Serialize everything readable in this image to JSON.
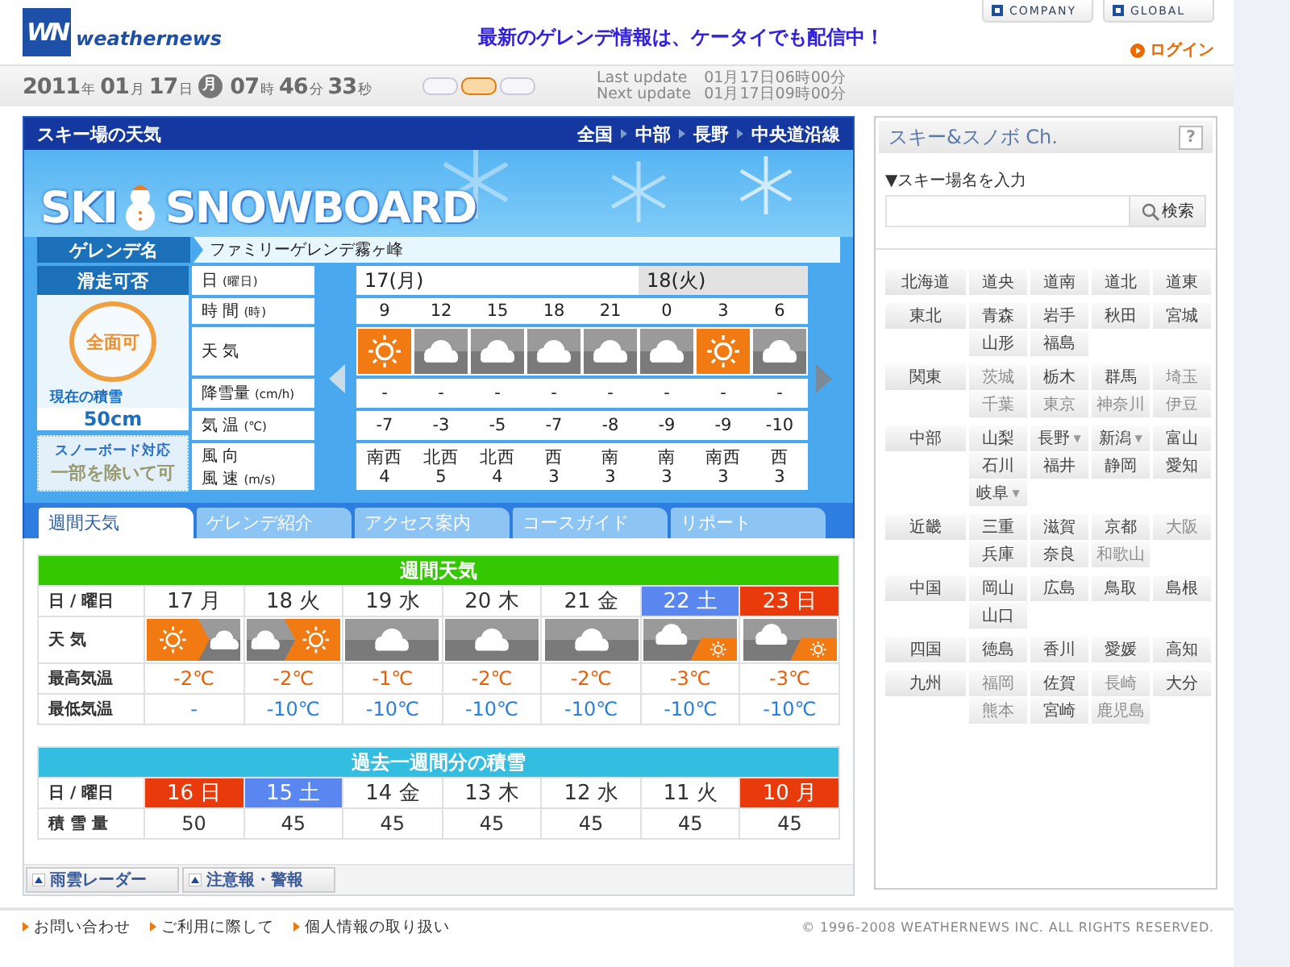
{
  "header": {
    "logo_mark": "WN",
    "logo_name": "weathernews",
    "banner": "最新のゲレンデ情報は、ケータイでも配信中！",
    "links": [
      "COMPANY",
      "GLOBAL"
    ],
    "login": "ログイン"
  },
  "datebar": {
    "clock": [
      {
        "value": "2011",
        "unit": "年"
      },
      {
        "value": "01",
        "unit": "月"
      },
      {
        "value": "17",
        "unit": "日"
      },
      {
        "kind": "weekday",
        "value": "月"
      },
      {
        "value": "07",
        "unit": "時"
      },
      {
        "value": "46",
        "unit": "分"
      },
      {
        "value": "33",
        "unit": "秒"
      }
    ],
    "modes": [
      {
        "selected": false
      },
      {
        "selected": true
      },
      {
        "selected": false
      }
    ],
    "updates": [
      {
        "label": "Last update",
        "value": "01月17日06時00分"
      },
      {
        "label": "Next update",
        "value": "01月17日09時00分"
      }
    ]
  },
  "panel": {
    "title": "スキー場の天気",
    "breadcrumb": [
      "全国",
      "中部",
      "長野",
      "中央道沿線"
    ],
    "art_words": [
      "SKI",
      "SNOWBOARD"
    ],
    "resort_label": "ゲレンデ名",
    "resort_name": "ファミリーゲレンデ霧ヶ峰",
    "status": {
      "title": "滑走可否",
      "verdict": "全面可",
      "snow_label": "現在の積雪",
      "snow_depth": "50cm",
      "board_label": "スノーボード対応",
      "board_value": "一部を除いて可"
    },
    "row_labels": [
      {
        "lines": [
          {
            "text": "日",
            "unit": "(曜日)"
          }
        ]
      },
      {
        "lines": [
          {
            "text": "時 間",
            "unit": "(時)"
          }
        ]
      },
      {
        "lines": [
          {
            "text": "天 気"
          }
        ]
      },
      {
        "lines": [
          {
            "text": "降雪量",
            "unit": "(cm/h)"
          }
        ]
      },
      {
        "lines": [
          {
            "text": "気 温",
            "unit": "(℃)"
          }
        ]
      },
      {
        "lines": [
          {
            "text": "風 向"
          },
          {
            "text": "風 速",
            "unit": "(m/s)"
          }
        ]
      }
    ],
    "days": [
      {
        "label": "17(月)",
        "shaded": false,
        "hours": [
          {
            "time": "9",
            "icon": {
              "kind": "sunny"
            },
            "snowfall": "-",
            "temp": "-7",
            "wind_dir": "南西",
            "wind_speed": "4"
          },
          {
            "time": "12",
            "icon": {
              "kind": "cloudy"
            },
            "snowfall": "-",
            "temp": "-3",
            "wind_dir": "北西",
            "wind_speed": "5"
          },
          {
            "time": "15",
            "icon": {
              "kind": "cloudy"
            },
            "snowfall": "-",
            "temp": "-5",
            "wind_dir": "北西",
            "wind_speed": "4"
          },
          {
            "time": "18",
            "icon": {
              "kind": "cloudy"
            },
            "snowfall": "-",
            "temp": "-7",
            "wind_dir": "西",
            "wind_speed": "3"
          },
          {
            "time": "21",
            "icon": {
              "kind": "cloudy"
            },
            "snowfall": "-",
            "temp": "-8",
            "wind_dir": "南",
            "wind_speed": "3"
          }
        ]
      },
      {
        "label": "18(火)",
        "shaded": true,
        "hours": [
          {
            "time": "0",
            "icon": {
              "kind": "cloudy"
            },
            "snowfall": "-",
            "temp": "-9",
            "wind_dir": "南",
            "wind_speed": "3"
          },
          {
            "time": "3",
            "icon": {
              "kind": "sunny"
            },
            "snowfall": "-",
            "temp": "-9",
            "wind_dir": "南西",
            "wind_speed": "3"
          },
          {
            "time": "6",
            "icon": {
              "kind": "cloudy"
            },
            "snowfall": "-",
            "temp": "-10",
            "wind_dir": "西",
            "wind_speed": "3"
          }
        ]
      }
    ]
  },
  "tabs": [
    {
      "label": "週間天気",
      "selected": true
    },
    {
      "label": "ゲレンデ紹介",
      "selected": false
    },
    {
      "label": "アクセス案内",
      "selected": false
    },
    {
      "label": "コースガイド",
      "selected": false
    },
    {
      "label": "リポート",
      "selected": false
    }
  ],
  "weekly": {
    "title": "週間天気",
    "row_labels": [
      "日 / 曜日",
      "天 気",
      "最高気温",
      "最低気温"
    ],
    "days": [
      {
        "label": "17 月",
        "kind": "weekday",
        "icon": {
          "kind": "sun_to_cloud"
        },
        "high": "-2℃",
        "low": "-"
      },
      {
        "label": "18 火",
        "kind": "weekday",
        "icon": {
          "kind": "cloud_to_sun"
        },
        "high": "-2℃",
        "low": "-10℃"
      },
      {
        "label": "19 水",
        "kind": "weekday",
        "icon": {
          "kind": "cloud"
        },
        "high": "-1℃",
        "low": "-10℃"
      },
      {
        "label": "20 木",
        "kind": "weekday",
        "icon": {
          "kind": "cloud"
        },
        "high": "-2℃",
        "low": "-10℃"
      },
      {
        "label": "21 金",
        "kind": "weekday",
        "icon": {
          "kind": "cloud"
        },
        "high": "-2℃",
        "low": "-10℃"
      },
      {
        "label": "22 土",
        "kind": "saturday",
        "icon": {
          "kind": "cloud_sometimes_sun"
        },
        "high": "-3℃",
        "low": "-10℃"
      },
      {
        "label": "23 日",
        "kind": "holiday",
        "icon": {
          "kind": "cloud_sometimes_sun"
        },
        "high": "-3℃",
        "low": "-10℃"
      }
    ]
  },
  "snow_history": {
    "title": "過去一週間分の積雪",
    "row_labels": [
      "日 / 曜日",
      "積 雪 量"
    ],
    "days": [
      {
        "label": "16 日",
        "kind": "holiday",
        "amount": "50"
      },
      {
        "label": "15 土",
        "kind": "saturday",
        "amount": "45"
      },
      {
        "label": "14 金",
        "kind": "weekday",
        "amount": "45"
      },
      {
        "label": "13 木",
        "kind": "weekday",
        "amount": "45"
      },
      {
        "label": "12 水",
        "kind": "weekday",
        "amount": "45"
      },
      {
        "label": "11 火",
        "kind": "weekday",
        "amount": "45"
      },
      {
        "label": "10 月",
        "kind": "holiday",
        "amount": "45"
      }
    ]
  },
  "bottom_links": [
    "雨雲レーダー",
    "注意報・警報"
  ],
  "sidebar": {
    "title": "スキー&スノボ Ch.",
    "help": "?",
    "search_label": "▼スキー場名を入力",
    "search_button": "検索",
    "regions": [
      {
        "name": "北海道",
        "prefectures": [
          {
            "name": "道央",
            "disabled": false
          },
          {
            "name": "道南",
            "disabled": false
          },
          {
            "name": "道北",
            "disabled": false
          },
          {
            "name": "道東",
            "disabled": false
          }
        ]
      },
      {
        "name": "東北",
        "prefectures": [
          {
            "name": "青森",
            "disabled": false
          },
          {
            "name": "岩手",
            "disabled": false
          },
          {
            "name": "秋田",
            "disabled": false
          },
          {
            "name": "宮城",
            "disabled": false
          },
          {
            "name": "山形",
            "disabled": false
          },
          {
            "name": "福島",
            "disabled": false
          }
        ]
      },
      {
        "name": "関東",
        "prefectures": [
          {
            "name": "茨城",
            "disabled": true
          },
          {
            "name": "栃木",
            "disabled": false
          },
          {
            "name": "群馬",
            "disabled": false
          },
          {
            "name": "埼玉",
            "disabled": true
          },
          {
            "name": "千葉",
            "disabled": true
          },
          {
            "name": "東京",
            "disabled": true
          },
          {
            "name": "神奈川",
            "disabled": true
          },
          {
            "name": "伊豆",
            "disabled": true
          }
        ]
      },
      {
        "name": "中部",
        "prefectures": [
          {
            "name": "山梨",
            "disabled": false
          },
          {
            "name": "長野",
            "disabled": false,
            "menu_mark": "▼"
          },
          {
            "name": "新潟",
            "disabled": false,
            "menu_mark": "▼"
          },
          {
            "name": "富山",
            "disabled": false
          },
          {
            "name": "石川",
            "disabled": false
          },
          {
            "name": "福井",
            "disabled": false
          },
          {
            "name": "静岡",
            "disabled": false
          },
          {
            "name": "愛知",
            "disabled": false
          },
          {
            "name": "岐阜",
            "disabled": false,
            "menu_mark": "▼"
          }
        ]
      },
      {
        "name": "近畿",
        "prefectures": [
          {
            "name": "三重",
            "disabled": false
          },
          {
            "name": "滋賀",
            "disabled": false
          },
          {
            "name": "京都",
            "disabled": false
          },
          {
            "name": "大阪",
            "disabled": true
          },
          {
            "name": "兵庫",
            "disabled": false
          },
          {
            "name": "奈良",
            "disabled": false
          },
          {
            "name": "和歌山",
            "disabled": true
          }
        ]
      },
      {
        "name": "中国",
        "prefectures": [
          {
            "name": "岡山",
            "disabled": false
          },
          {
            "name": "広島",
            "disabled": false
          },
          {
            "name": "鳥取",
            "disabled": false
          },
          {
            "name": "島根",
            "disabled": false
          },
          {
            "name": "山口",
            "disabled": false
          }
        ]
      },
      {
        "name": "四国",
        "prefectures": [
          {
            "name": "徳島",
            "disabled": false
          },
          {
            "name": "香川",
            "disabled": false
          },
          {
            "name": "愛媛",
            "disabled": false
          },
          {
            "name": "高知",
            "disabled": false
          }
        ]
      },
      {
        "name": "九州",
        "prefectures": [
          {
            "name": "福岡",
            "disabled": true
          },
          {
            "name": "佐賀",
            "disabled": false
          },
          {
            "name": "長崎",
            "disabled": true
          },
          {
            "name": "大分",
            "disabled": false
          },
          {
            "name": "熊本",
            "disabled": true
          },
          {
            "name": "宮崎",
            "disabled": false
          },
          {
            "name": "鹿児島",
            "disabled": true
          }
        ]
      }
    ]
  },
  "footer": {
    "links": [
      "お問い合わせ",
      "ご利用に際して",
      "個人情報の取り扱い"
    ],
    "copyright": "© 1996-2008 WEATHERNEWS INC. ALL RIGHTS RESERVED."
  }
}
